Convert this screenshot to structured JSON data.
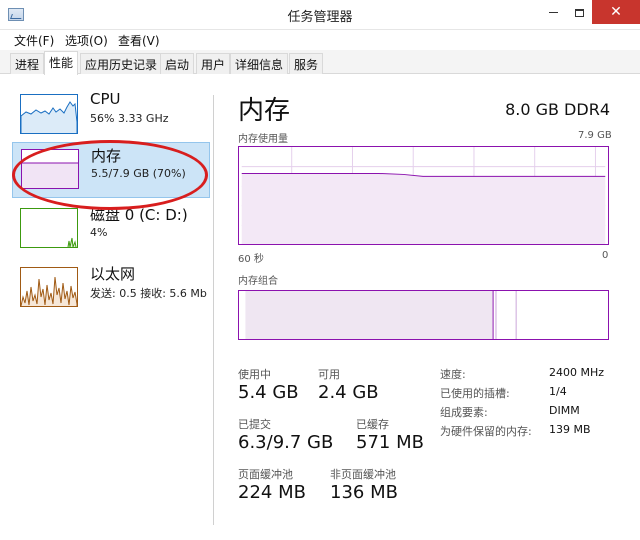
{
  "window": {
    "title": "任务管理器",
    "close_glyph": "✕"
  },
  "menu": [
    "文件(F)",
    "选项(O)",
    "查看(V)"
  ],
  "tabs": [
    "进程",
    "性能",
    "应用历史记录",
    "启动",
    "用户",
    "详细信息",
    "服务"
  ],
  "active_tab": "性能",
  "sidebar": {
    "items": [
      {
        "title": "CPU",
        "subtitle": "56% 3.33 GHz"
      },
      {
        "title": "内存",
        "subtitle": "5.5/7.9 GB (70%)"
      },
      {
        "title": "磁盘 0 (C: D:)",
        "subtitle": "4%"
      },
      {
        "title": "以太网",
        "subtitle": "发送: 0.5  接收: 5.6 Mb"
      }
    ],
    "selected": "内存"
  },
  "main": {
    "title": "内存",
    "spec": "8.0 GB DDR4",
    "usage_graph": {
      "label": "内存使用量",
      "max_label": "7.9 GB",
      "time_left": "60 秒",
      "time_right": "0"
    },
    "composition_label": "内存组合",
    "stats": {
      "in_use_label": "使用中",
      "in_use": "5.4 GB",
      "available_label": "可用",
      "available": "2.4 GB",
      "committed_label": "已提交",
      "committed": "6.3/9.7 GB",
      "cached_label": "已缓存",
      "cached": "571 MB",
      "paged_label": "页面缓冲池",
      "paged": "224 MB",
      "nonpaged_label": "非页面缓冲池",
      "nonpaged": "136 MB"
    },
    "details": [
      {
        "key": "速度:",
        "value": "2400 MHz"
      },
      {
        "key": "已使用的插槽:",
        "value": "1/4"
      },
      {
        "key": "组成要素:",
        "value": "DIMM"
      },
      {
        "key": "为硬件保留的内存:",
        "value": "139 MB"
      }
    ]
  },
  "colors": {
    "memory_accent": "#8b12ae",
    "cpu_accent": "#1a6fc2",
    "disk_accent": "#3c9a0f",
    "net_accent": "#a05a14",
    "annotation_red": "#d81e1e"
  }
}
